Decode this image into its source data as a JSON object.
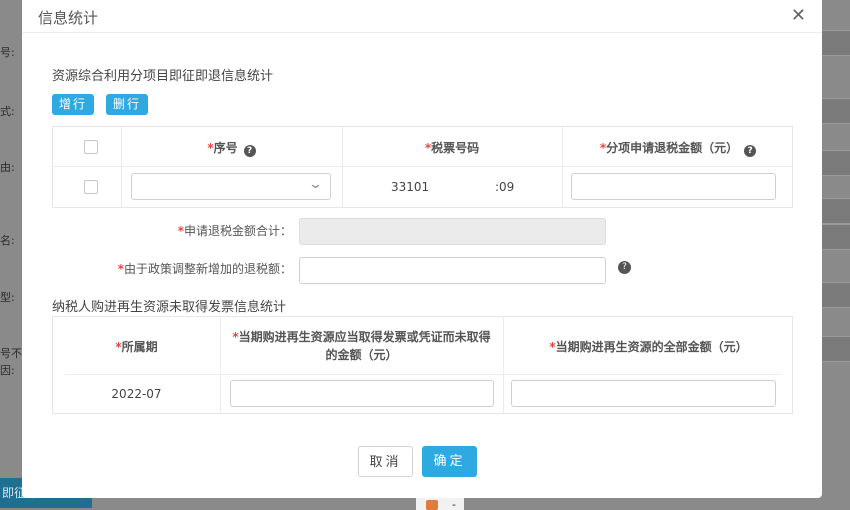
{
  "background": {
    "labels": [
      "号:",
      "式:",
      "由:",
      "名:",
      "型:",
      "号不",
      "因:"
    ],
    "bottom_button": "即征即退"
  },
  "modal": {
    "title": "信息统计",
    "close_icon": "close-icon"
  },
  "section1": {
    "title": "资源综合利用分项目即征即退信息统计",
    "add_row": "增行",
    "del_row": "删行",
    "headers": {
      "seq": "序号",
      "invoice_no": "税票号码",
      "refund_amount": "分项申请退税金额（元）"
    },
    "rows": [
      {
        "seq": "",
        "invoice_no": "33101",
        "invoice_no_tail": ":09",
        "refund_amount": ""
      }
    ]
  },
  "form": {
    "total_label": "申请退税金额合计：",
    "total_value": "",
    "policy_label": "由于政策调整新增加的退税额：",
    "policy_value": ""
  },
  "section2": {
    "title": "纳税人购进再生资源未取得发票信息统计",
    "headers": {
      "period": "所属期",
      "no_invoice_line1": "当期购进再生资源应当取得发票或凭证而未取得",
      "no_invoice_line2": "的金额（元）",
      "all_amount": "当期购进再生资源的全部金额（元）"
    },
    "rows": [
      {
        "period": "2022-07",
        "no_invoice_amount": "",
        "all_amount": ""
      }
    ]
  },
  "footer": {
    "cancel": "取消",
    "confirm": "确定"
  },
  "colors": {
    "primary": "#2fa9e2",
    "required": "#e64545",
    "overlay": "#8a8a8a"
  }
}
